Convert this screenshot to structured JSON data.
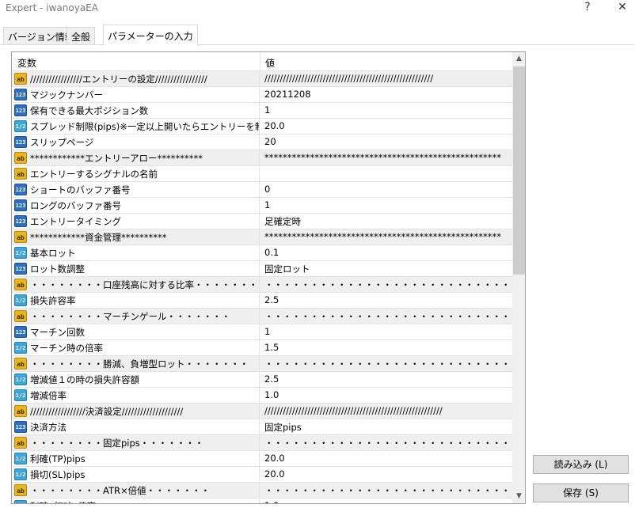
{
  "window": {
    "title": "Expert - iwanoyaEA",
    "help_label": "?",
    "close_label": "✕"
  },
  "tabs": [
    {
      "label": "バージョン情報"
    },
    {
      "label": "全般"
    },
    {
      "label": "パラメーターの入力"
    }
  ],
  "table": {
    "col_name": "変数",
    "col_value": "値",
    "rows": [
      {
        "icon": "ab",
        "name": "/////////////////エントリーの設定/////////////////",
        "value": "///////////////////////////////////////////////////////",
        "gray": true
      },
      {
        "icon": "123",
        "name": "マジックナンバー",
        "value": "20211208",
        "gray": false
      },
      {
        "icon": "123",
        "name": "保有できる最大ポジション数",
        "value": "1",
        "gray": false
      },
      {
        "icon": "1/2",
        "name": "スプレッド制限(pips)※一定以上開いたらエントリーを制限",
        "value": "20.0",
        "gray": false
      },
      {
        "icon": "123",
        "name": "スリップページ",
        "value": "20",
        "gray": false
      },
      {
        "icon": "ab",
        "name": "************エントリーアロー**********",
        "value": "****************************************************",
        "gray": true
      },
      {
        "icon": "ab",
        "name": "エントリーするシグナルの名前",
        "value": "",
        "gray": false
      },
      {
        "icon": "123",
        "name": "ショートのバッファ番号",
        "value": "0",
        "gray": false
      },
      {
        "icon": "123",
        "name": "ロングのバッファ番号",
        "value": "1",
        "gray": false
      },
      {
        "icon": "123",
        "name": "エントリータイミング",
        "value": "足確定時",
        "gray": false
      },
      {
        "icon": "ab",
        "name": "************資金管理**********",
        "value": "****************************************************",
        "gray": true
      },
      {
        "icon": "1/2",
        "name": "基本ロット",
        "value": "0.1",
        "gray": false
      },
      {
        "icon": "123",
        "name": "ロット数調整",
        "value": "固定ロット",
        "gray": false
      },
      {
        "icon": "ab",
        "name": "・・・・・・・・口座残高に対する比率・・・・・・・",
        "value": "・・・・・・・・・・・・・・・・・・・・・・・・・・・",
        "gray": true
      },
      {
        "icon": "1/2",
        "name": "損失許容率",
        "value": "2.5",
        "gray": false
      },
      {
        "icon": "ab",
        "name": "・・・・・・・・マーチンゲール・・・・・・・",
        "value": "・・・・・・・・・・・・・・・・・・・・・・・・・・・",
        "gray": true
      },
      {
        "icon": "123",
        "name": "マーチン回数",
        "value": "1",
        "gray": false
      },
      {
        "icon": "1/2",
        "name": "マーチン時の倍率",
        "value": "1.5",
        "gray": false
      },
      {
        "icon": "ab",
        "name": "・・・・・・・・勝減、負増型ロット・・・・・・・",
        "value": "・・・・・・・・・・・・・・・・・・・・・・・・・・・",
        "gray": true
      },
      {
        "icon": "1/2",
        "name": "増減値１の時の損失許容額",
        "value": "2.5",
        "gray": false
      },
      {
        "icon": "1/2",
        "name": "増減倍率",
        "value": "1.0",
        "gray": false
      },
      {
        "icon": "ab",
        "name": "//////////////////決済設定////////////////////",
        "value": "//////////////////////////////////////////////////////////",
        "gray": true
      },
      {
        "icon": "123",
        "name": "決済方法",
        "value": "固定pips",
        "gray": false
      },
      {
        "icon": "ab",
        "name": "・・・・・・・・固定pips・・・・・・・",
        "value": "・・・・・・・・・・・・・・・・・・・・・・・・・・・",
        "gray": true
      },
      {
        "icon": "1/2",
        "name": "利確(TP)pips",
        "value": "20.0",
        "gray": false
      },
      {
        "icon": "1/2",
        "name": "損切(SL)pips",
        "value": "20.0",
        "gray": false
      },
      {
        "icon": "ab",
        "name": "・・・・・・・・ATR×倍値・・・・・・・",
        "value": "・・・・・・・・・・・・・・・・・・・・・・・・・・・",
        "gray": true
      },
      {
        "icon": "1/2",
        "name": "利確（TP）倍率",
        "value": "1.0",
        "gray": false
      }
    ]
  },
  "buttons": {
    "load": "読み込み (L)",
    "save": "保存 (S)"
  }
}
